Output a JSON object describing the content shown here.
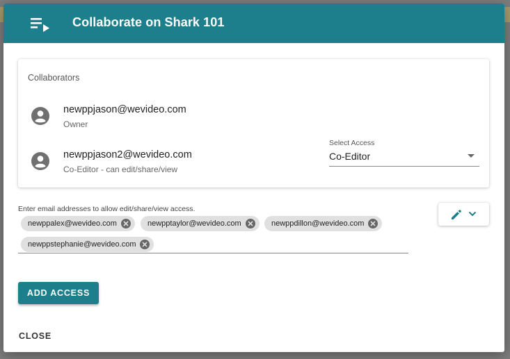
{
  "dialog": {
    "title": "Collaborate on Shark 101",
    "header_icon": "playlist-play-icon",
    "accent_color": "#1e7f8c"
  },
  "collaborators": {
    "title": "Collaborators",
    "items": [
      {
        "email": "newppjason@wevideo.com",
        "role": "Owner",
        "icon": "account-circle-icon"
      },
      {
        "email": "newppjason2@wevideo.com",
        "role": "Co-Editor - can edit/share/view",
        "icon": "account-circle-icon"
      }
    ],
    "access_select": {
      "label": "Select Access",
      "value": "Co-Editor"
    }
  },
  "invite": {
    "hint": "Enter email addresses to allow edit/share/view access.",
    "chips": [
      "newppalex@wevideo.com",
      "newpptaylor@wevideo.com",
      "newppdillon@wevideo.com",
      "newppstephanie@wevideo.com"
    ],
    "permission_menu_icon": "pencil-icon"
  },
  "actions": {
    "add_access": "ADD ACCESS",
    "close": "CLOSE"
  }
}
